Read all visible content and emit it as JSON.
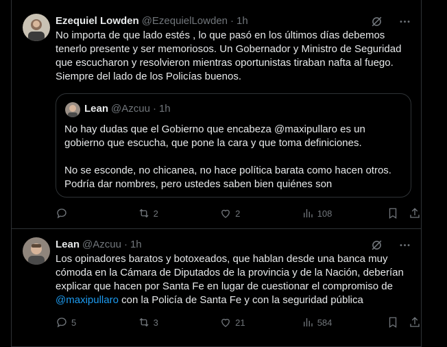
{
  "tweets": [
    {
      "name": "Ezequiel Lowden",
      "handle": "@EzequielLowden",
      "time": "1h",
      "text": "No importa de que lado estés , lo que pasó en los últimos días debemos tenerlo presente y ser memoriosos. Un Gobernador y Ministro de Seguridad que escucharon y resolvieron mientras oportunistas tiraban nafta al fuego. Siempre del lado de los Policías buenos.",
      "quote": {
        "name": "Lean",
        "handle": "@Azcuu",
        "time": "1h",
        "text": "No hay dudas que el Gobierno que encabeza @maxipullaro es un gobierno que escucha, que pone la cara y que toma definiciones.\n\nNo se esconde, no chicanea, no hace política barata como hacen otros. Podría dar nombres, pero ustedes saben bien quiénes son"
      },
      "replies": "",
      "retweets": "2",
      "likes": "2",
      "views": "108"
    },
    {
      "name": "Lean",
      "handle": "@Azcuu",
      "time": "1h",
      "text_before": "Los opinadores baratos y botoxeados, que hablan desde una banca muy cómoda en la Cámara de Diputados de la provincia y de la Nación, deberían explicar que hacen por Santa Fe en lugar de cuestionar el compromiso de ",
      "mention": "@maxipullaro",
      "text_after": " con la Policía de Santa Fe y con la seguridad pública",
      "replies": "5",
      "retweets": "3",
      "likes": "21",
      "views": "584"
    }
  ],
  "separator": "·",
  "icons": [
    "grok-icon",
    "more-icon",
    "reply-icon",
    "retweet-icon",
    "like-icon",
    "views-icon",
    "bookmark-icon",
    "share-icon"
  ],
  "colors": {
    "background": "#000000",
    "text": "#e7e9ea",
    "secondary": "#71767b",
    "border": "#2f3336",
    "accent": "#1d9bf0"
  }
}
